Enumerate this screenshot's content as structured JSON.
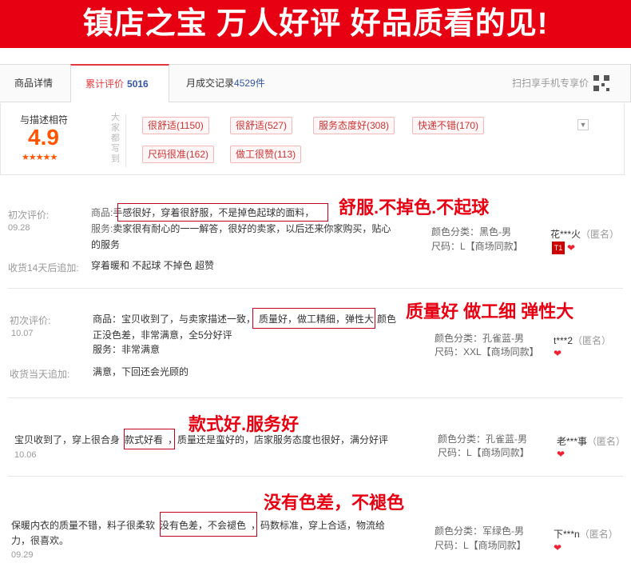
{
  "banner": "镇店之宝 万人好评 好品质看的见!",
  "tabs": {
    "details": "商品详情",
    "reviews_label": "累计评价",
    "reviews_count": "5016",
    "sales_label": "月成交记录",
    "sales_count": "4529件",
    "scan": "扫扫享手机专享价"
  },
  "summary": {
    "label": "与描述相符",
    "score": "4.9",
    "stars": "★★★★★",
    "vertical_label": "大家都写到",
    "tags": [
      "很舒适(1150)",
      "很舒适(527)",
      "服务态度好(308)",
      "快递不错(170)",
      "尺码很准(162)",
      "做工很赞(113)"
    ],
    "dropdown_icon": "chevron-down-icon"
  },
  "reviews": [
    {
      "first_label": "初次评价:",
      "date": "09.28",
      "line1_key": "商品:",
      "line1": "手感很好，穿着很舒服，不是掉色起球的面料，",
      "line2_key": "服务:",
      "line2": "卖家很有耐心的一一解答，很好的卖家，以后还来你家购买，贴心",
      "line3": "的服务",
      "append_label": "收货14天后追加:",
      "append_text": "穿着暖和 不起球 不掉色 超赞",
      "color": "颜色分类：黑色-男",
      "size": "尺码：L【商场同款】",
      "user": "花***火",
      "anon": "（匿名）",
      "badge": "T1",
      "callout": "舒服.不掉色.不起球"
    },
    {
      "first_label": "初次评价:",
      "date": "10.07",
      "line1a": "商品：宝贝收到了，与卖家描述一致，",
      "line1b": "质量好，做工精细，弹性大",
      "line1c": "颜色",
      "line2": "正没色差，非常满意，全5分好评",
      "line3": "服务：非常满意",
      "append_label": "收货当天追加:",
      "append_text": "满意，下回还会光顾的",
      "color": "颜色分类：孔雀蓝-男",
      "size": "尺码：XXL【商场同款】",
      "user": "t***2",
      "anon": "（匿名）",
      "callout": "质量好 做工细 弹性大"
    },
    {
      "line1a": "宝贝收到了，穿上很合身",
      "line1b": "款式好看",
      "line1c": "，质量还是蛮好的，店家服务态度也很好，满分好评",
      "date": "10.06",
      "color": "颜色分类：孔雀蓝-男",
      "size": "尺码：L【商场同款】",
      "user": "老***事",
      "anon": "（匿名）",
      "callout": "款式好.服务好"
    },
    {
      "line1a": "保暖内衣的质量不错，料子很柔软",
      "line1b": "没有色差，不会褪色",
      "line1c": "，码数标准，穿上合适，物流给",
      "line2": "力，很喜欢。",
      "date": "09.29",
      "color": "颜色分类：军绿色-男",
      "size": "尺码：L【商场同款】",
      "user": "下***n",
      "anon": "（匿名）",
      "callout": "没有色差，不褪色"
    }
  ],
  "colors": {
    "accent": "#e60012",
    "score": "#ff5500",
    "tag_text": "#cc3333",
    "count_blue": "#3355aa"
  }
}
